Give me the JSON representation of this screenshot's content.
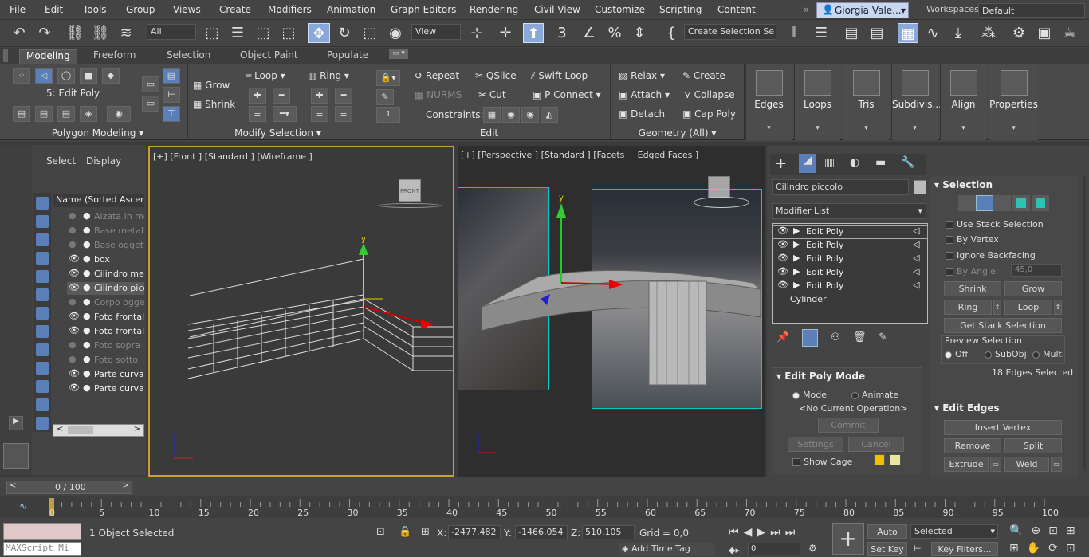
{
  "menu": [
    "File",
    "Edit",
    "Tools",
    "Group",
    "Views",
    "Create",
    "Modifiers",
    "Animation",
    "Graph Editors",
    "Rendering",
    "Civil View",
    "Customize",
    "Scripting",
    "Content"
  ],
  "user": {
    "name": "Giorgia Vale..."
  },
  "workspaces": {
    "label": "Workspaces:",
    "value": "Default"
  },
  "toolbar": {
    "filter": "All",
    "refcoord": "View",
    "selection_set": "Create Selection Se"
  },
  "ribbon_tabs": [
    "Modeling",
    "Freeform",
    "Selection",
    "Object Paint",
    "Populate"
  ],
  "ribbon": {
    "object_level": "5: Edit Poly",
    "polygon_modeling": "Polygon Modeling",
    "grow": "Grow",
    "shrink": "Shrink",
    "loop": "Loop",
    "ring": "Ring",
    "modify_selection": "Modify Selection",
    "repeat": "Repeat",
    "qslice": "QSlice",
    "swift_loop": "Swift Loop",
    "nurms": "NURMS",
    "cut": "Cut",
    "p_connect": "P Connect",
    "constraints": "Constraints:",
    "spinner_value": "1",
    "edit": "Edit",
    "relax": "Relax",
    "create": "Create",
    "attach": "Attach",
    "collapse": "Collapse",
    "detach": "Detach",
    "cap_poly": "Cap Poly",
    "geometry": "Geometry (All)",
    "big_buttons": [
      "Edges",
      "Loops",
      "Tris",
      "Subdivis...",
      "Align",
      "Properties"
    ]
  },
  "scene_explorer": {
    "tabs": [
      "Select",
      "Display"
    ],
    "column": "Name (Sorted Ascendin",
    "items": [
      {
        "name": "Alzata in me",
        "visible": false
      },
      {
        "name": "Base metallo",
        "visible": false
      },
      {
        "name": "Base oggett",
        "visible": false
      },
      {
        "name": "box",
        "visible": true
      },
      {
        "name": "Cilindro meta",
        "visible": true
      },
      {
        "name": "Cilindro picco",
        "visible": true
      },
      {
        "name": "Corpo ogge",
        "visible": false
      },
      {
        "name": "Foto frontal",
        "visible": true
      },
      {
        "name": "Foto frontal",
        "visible": true
      },
      {
        "name": "Foto sopra",
        "visible": false
      },
      {
        "name": "Foto sotto",
        "visible": false
      },
      {
        "name": "Parte curva",
        "visible": true
      },
      {
        "name": "Parte curva",
        "visible": true
      }
    ]
  },
  "viewports": {
    "front": "[+] [Front ] [Standard ] [Wireframe ]",
    "persp": "[+] [Perspective ] [Standard ] [Facets + Edged Faces ]",
    "front_cube": "FRONT"
  },
  "command_panel": {
    "object_name": "Cilindro piccolo",
    "modifier_list": "Modifier List",
    "stack": [
      "Edit Poly",
      "Edit Poly",
      "Edit Poly",
      "Edit Poly",
      "Edit Poly",
      "Cylinder"
    ],
    "edit_poly_mode": "Edit Poly Mode",
    "model": "Model",
    "animate": "Animate",
    "no_op": "<No Current Operation>",
    "commit": "Commit",
    "settings": "Settings",
    "cancel": "Cancel",
    "show_cage": "Show Cage"
  },
  "selection_rollout": {
    "title": "Selection",
    "use_stack": "Use Stack Selection",
    "by_vertex": "By Vertex",
    "ignore_backfacing": "Ignore Backfacing",
    "by_angle": "By Angle:",
    "angle": "45,0",
    "shrink": "Shrink",
    "grow": "Grow",
    "ring": "Ring",
    "loop": "Loop",
    "get_stack": "Get Stack Selection",
    "preview": "Preview Selection",
    "off": "Off",
    "subobj": "SubObj",
    "multi": "Multi",
    "status": "18 Edges Selected"
  },
  "edit_edges": {
    "title": "Edit Edges",
    "insert_vertex": "Insert Vertex",
    "remove": "Remove",
    "split": "Split",
    "extrude": "Extrude",
    "weld": "Weld"
  },
  "timeline": {
    "frame": "0 / 100",
    "ticks": [
      "0",
      "5",
      "10",
      "15",
      "20",
      "25",
      "30",
      "35",
      "40",
      "45",
      "50",
      "55",
      "60",
      "65",
      "70",
      "75",
      "80",
      "85",
      "90",
      "95",
      "100"
    ]
  },
  "status": {
    "objects": "1 Object Selected",
    "x": "-2477,482",
    "y": "-1466,054",
    "z": "510,105",
    "grid": "Grid = 0,0",
    "add_time_tag": "Add Time Tag",
    "auto_key": "Auto Key",
    "set_key": "Set Key",
    "key_mode": "Selected",
    "key_filters": "Key Filters...",
    "current_frame": "0",
    "maxscript": "MAXScript Mi"
  },
  "colors": {
    "accent": "#8aa8d8",
    "viewport_border": "#c8a030",
    "cage1": "#f0c000",
    "cage2": "#e8e6a0"
  }
}
